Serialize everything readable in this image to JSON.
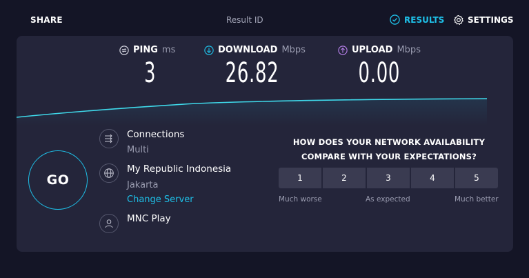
{
  "header": {
    "share_label": "SHARE",
    "result_id_label": "Result ID",
    "results_label": "RESULTS",
    "settings_label": "SETTINGS"
  },
  "metrics": {
    "ping": {
      "label": "PING",
      "unit": "ms",
      "value": "3"
    },
    "download": {
      "label": "DOWNLOAD",
      "unit": "Mbps",
      "value": "26.82"
    },
    "upload": {
      "label": "UPLOAD",
      "unit": "Mbps",
      "value": "0.00"
    }
  },
  "go_label": "GO",
  "connections": {
    "title": "Connections",
    "value": "Multi"
  },
  "server": {
    "title": "My Republic Indonesia",
    "location": "Jakarta",
    "change_label": "Change Server"
  },
  "provider": {
    "name": "MNC Play"
  },
  "survey": {
    "question_line1": "HOW DOES YOUR NETWORK AVAILABILITY",
    "question_line2": "COMPARE WITH YOUR EXPECTATIONS?",
    "options": [
      "1",
      "2",
      "3",
      "4",
      "5"
    ],
    "low_label": "Much worse",
    "mid_label": "As expected",
    "high_label": "Much better"
  },
  "colors": {
    "accent": "#1ec0e8",
    "upload": "#b57fe8",
    "card": "#24253a",
    "background": "#141526"
  },
  "icons": {
    "ping": "ping-icon",
    "download": "download-arrow-icon",
    "upload": "upload-arrow-icon",
    "results": "check-circle-icon",
    "settings": "gear-icon",
    "connections": "connections-arrows-icon",
    "server": "globe-icon",
    "provider": "user-icon"
  }
}
